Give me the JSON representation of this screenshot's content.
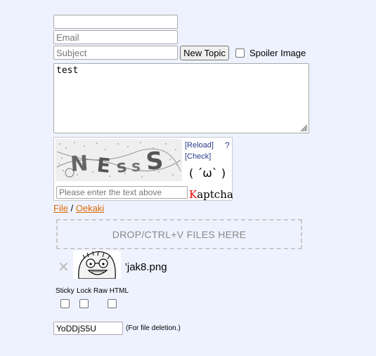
{
  "form": {
    "name_value": "",
    "email_placeholder": "Email",
    "subject_placeholder": "Subject",
    "new_topic_label": "New Topic",
    "spoiler_label": "Spoiler Image",
    "comment_value": "test"
  },
  "captcha": {
    "reload_label": "[Reload]",
    "check_label": "[Check]",
    "help_label": "?",
    "face": "( ´ω` )",
    "input_placeholder": "Please enter the text above",
    "brand_k": "K",
    "brand_rest": "aptcha",
    "image_text": "NESS"
  },
  "upload": {
    "file_label": "File",
    "separator": "/",
    "oekaki_label": "Oekaki",
    "drop_label": "DROP/CTRL+V FILES HERE",
    "remove_icon": "✕",
    "filename": "'jak8.png"
  },
  "options": {
    "sticky_label": "Sticky",
    "lock_label": "Lock",
    "raw_label": "Raw HTML"
  },
  "password": {
    "value": "YoDDjS5U",
    "note": "(For file deletion.)"
  },
  "colors": {
    "background": "#eef2ff",
    "link_orange": "#e06b00",
    "kaptcha_red": "#e00000",
    "captcha_link": "#2a3b8c"
  }
}
